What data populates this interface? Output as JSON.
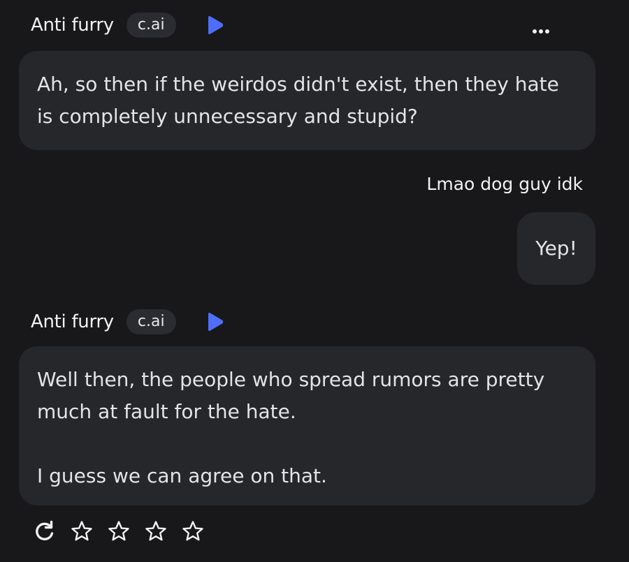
{
  "messages": [
    {
      "sender": "Anti furry",
      "tag": "c.ai",
      "text": "Ah, so then if the weirdos didn't exist, then they hate\nis completely unnecessary and stupid?"
    },
    {
      "sender": "Lmao dog guy idk",
      "text": "Yep!"
    },
    {
      "sender": "Anti furry",
      "tag": "c.ai",
      "text": "Well then, the people who spread rumors are pretty\nmuch at fault for the hate.\n\nI guess we can agree on that."
    }
  ],
  "icons": {
    "play": "play-icon",
    "more": "more-options-icon",
    "regenerate": "regenerate-icon",
    "star": "star-icon"
  },
  "rating": {
    "max": 4,
    "value": 0
  },
  "colors": {
    "background": "#18181b",
    "bubble": "#26272b",
    "tag_bg": "#2b2c31",
    "accent_blue": "#4f6ef7"
  }
}
